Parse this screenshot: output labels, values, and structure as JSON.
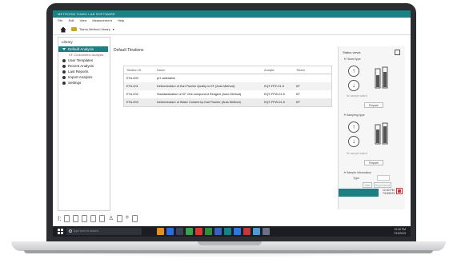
{
  "window": {
    "title": "METROHM TIAMO LAB SOFTWARE",
    "menu": [
      "File",
      "Edit",
      "View",
      "Measurement",
      "Help"
    ],
    "breadcrumb": "Tiamo Method Library"
  },
  "library": {
    "title": "Library",
    "items": [
      {
        "label": "Default Analysis",
        "active": true
      },
      {
        "label": "KF Coulometric Analysis",
        "sub": true
      },
      {
        "label": "User Templates"
      },
      {
        "label": "Recent Analysis"
      },
      {
        "label": "Last Reports"
      },
      {
        "label": "Import Analysis"
      },
      {
        "label": "Settings"
      }
    ]
  },
  "main": {
    "title": "Default Titrations",
    "columns": [
      "Titration ID",
      "Name",
      "Analyte",
      "Titrant"
    ],
    "rows": [
      [
        "ETA-000",
        "pH calibration",
        "",
        ""
      ],
      [
        "ETA-001",
        "Determination of Karl Fischer Quality in KF (Auto Method)",
        "KQT-FFE-01-5",
        "KF"
      ],
      [
        "ETA-002",
        "Standardization of KF One-component Reagent (Auto Method)",
        "KQT-FFW-01-5",
        "KF"
      ],
      [
        "ETA-003",
        "Determination of Water Content by Karl Fischer (Auto Method)",
        "KQT-FFW-01-5",
        "KF"
      ]
    ]
  },
  "right_panel": {
    "title": "Status views",
    "sections": [
      "Titrant type",
      "Sampling type",
      "Sample information"
    ],
    "status_text": "No sample loaded",
    "prepare_label": "Prepare",
    "type_label": "Type",
    "start_label": "Start",
    "stop_label": "Stop/Cancel"
  },
  "taskbar": {
    "search_placeholder": "Type here to search",
    "clock_time": "12:40 PM",
    "clock_date": "7/15/2023"
  },
  "colors": {
    "accent": "#1c7f84",
    "taskbar": "#1b1d22"
  }
}
